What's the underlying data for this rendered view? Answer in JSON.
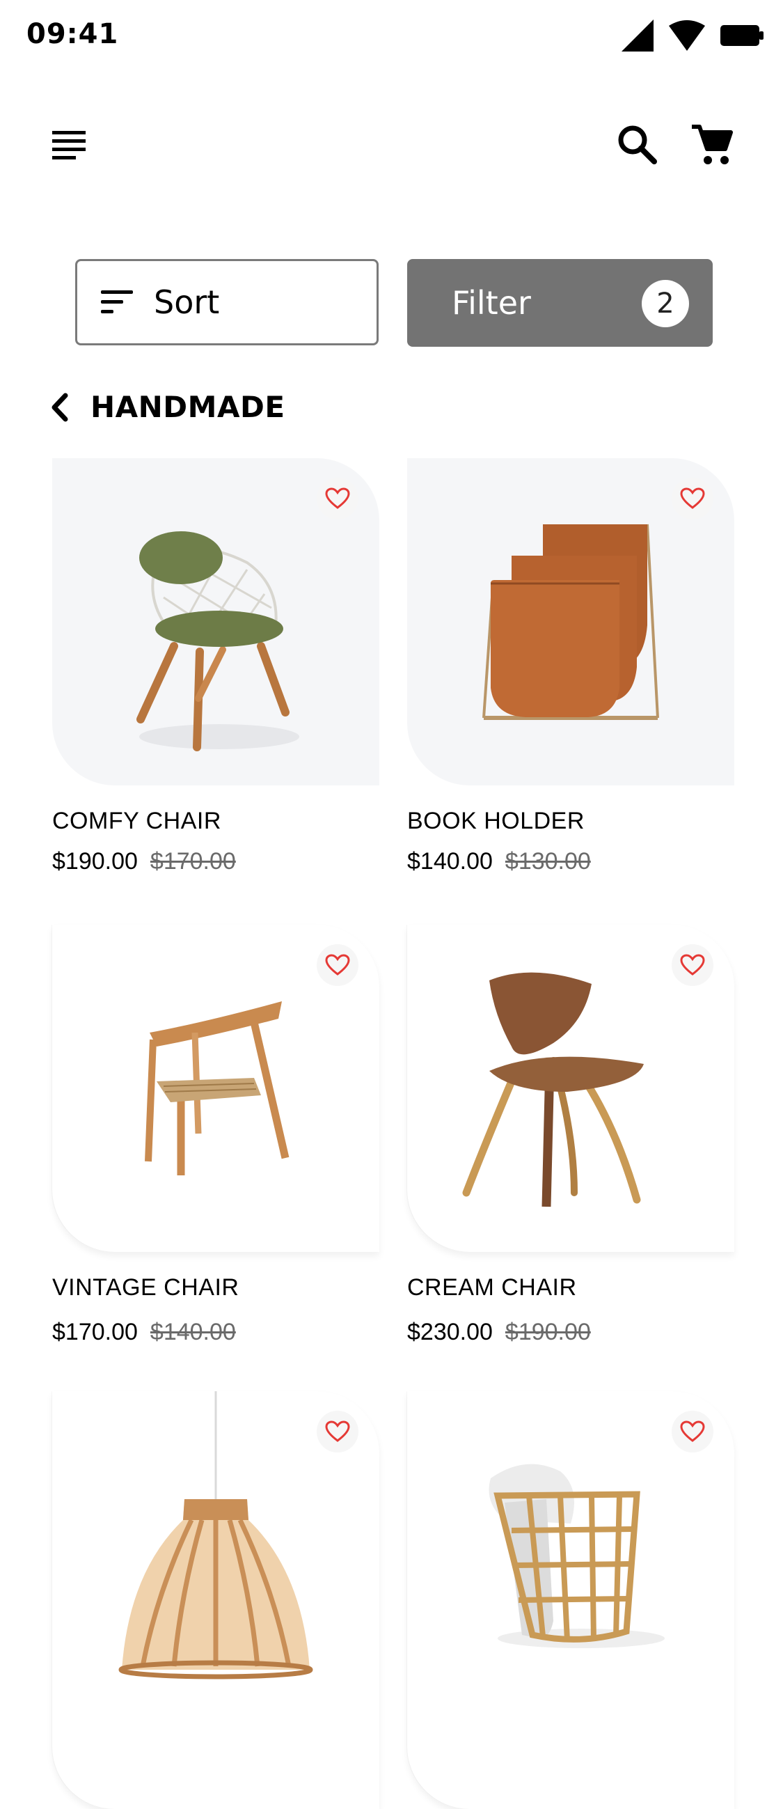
{
  "status": {
    "time": "09:41"
  },
  "toolbar": {
    "sort_label": "Sort",
    "filter_label": "Filter",
    "filter_count": "2"
  },
  "category": {
    "title": "HANDMADE"
  },
  "products": [
    {
      "name": "COMFY CHAIR",
      "price": "$190.00",
      "old_price": "$170.00"
    },
    {
      "name": "BOOK HOLDER",
      "price": "$140.00",
      "old_price": "$130.00"
    },
    {
      "name": "VINTAGE CHAIR",
      "price": "$170.00",
      "old_price": "$140.00"
    },
    {
      "name": "CREAM CHAIR",
      "price": "$230.00",
      "old_price": "$190.00"
    },
    {
      "name": "",
      "price": "",
      "old_price": ""
    },
    {
      "name": "",
      "price": "",
      "old_price": ""
    }
  ],
  "icons": {
    "menu": "menu-icon",
    "search": "search-icon",
    "cart": "cart-icon",
    "sort": "sort-icon",
    "back": "chevron-left-icon",
    "favorite": "heart-outline-icon"
  },
  "colors": {
    "filter_bg": "#737373",
    "heart": "#e53935",
    "card_bg": "#f5f6f8"
  }
}
